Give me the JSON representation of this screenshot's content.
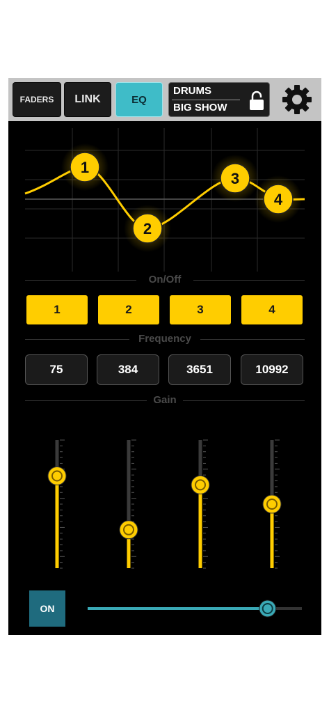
{
  "topbar": {
    "faders_label": "FADERS",
    "link_label": "LINK",
    "eq_label": "EQ",
    "scene_line1": "DRUMS",
    "scene_line2": "BIG SHOW"
  },
  "eq_nodes": [
    "1",
    "2",
    "3",
    "4"
  ],
  "sections": {
    "onoff": "On/Off",
    "frequency": "Frequency",
    "gain": "Gain"
  },
  "bands": [
    "1",
    "2",
    "3",
    "4"
  ],
  "frequencies": [
    "75",
    "384",
    "3651",
    "10992"
  ],
  "gain_levels": [
    0.72,
    0.3,
    0.65,
    0.5
  ],
  "output": {
    "on_label": "ON",
    "level": 0.84
  },
  "colors": {
    "accent": "#ffcd00",
    "active_tab": "#3fbcc8",
    "on_button": "#1f6b7e",
    "slider": "#3aa9b6"
  }
}
